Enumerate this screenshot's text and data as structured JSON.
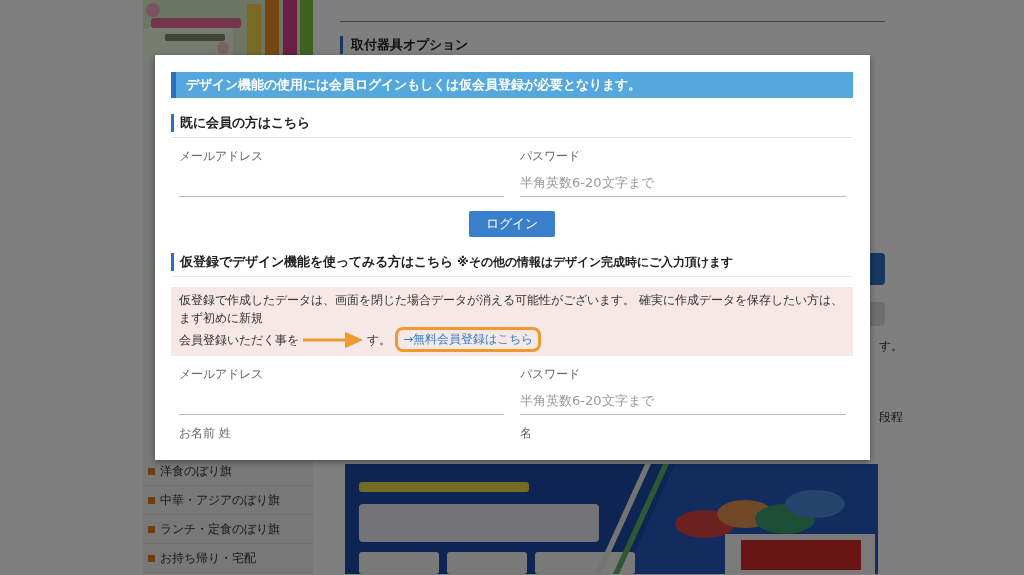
{
  "sidebar": {
    "items": [
      {
        "label": "洋食のぼり旗"
      },
      {
        "label": "中華・アジアのぼり旗"
      },
      {
        "label": "ランチ・定食のぼり旗"
      },
      {
        "label": "お持ち帰り・宅配"
      }
    ]
  },
  "main": {
    "heading": "取付器具オプション",
    "notes": [
      "す。",
      "段程"
    ]
  },
  "modal": {
    "banner": "デザイン機能の使用には会員ログインもしくは仮会員登録が必要となります。",
    "login_section": {
      "heading": "既に会員の方はこちら",
      "fields": [
        {
          "label": "メールアドレス"
        },
        {
          "label": "パスワード",
          "placeholder": "半角英数6-20文字まで"
        }
      ],
      "button": "ログイン"
    },
    "trial_section": {
      "heading": "仮登録でデザイン機能を使ってみる方はこちら",
      "note": "※その他の情報はデザイン完成時にご入力頂けます",
      "notice": {
        "lines": [
          "仮登録で作成したデータは、画面を閉じた場合データが消える可能性がございます。 確実に作成データを保存したい方は、まず初めに新規",
          "会員登録いただく事を"
        ],
        "tail": "す。",
        "link": "→無料会員登録はこちら",
        "highlighted": true
      },
      "fields": [
        {
          "label": "メールアドレス",
          "kind": "input"
        },
        {
          "label": "パスワード",
          "placeholder": "半角英数6-20文字まで",
          "kind": "input"
        },
        {
          "label": "お名前 姓",
          "kind": "label"
        },
        {
          "label": "名",
          "kind": "label"
        }
      ]
    }
  }
}
